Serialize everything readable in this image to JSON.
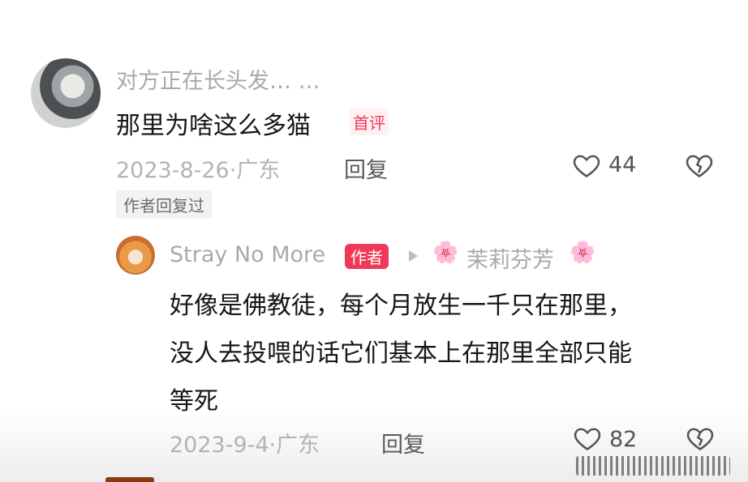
{
  "comment1": {
    "username": "对方正在长头发… …",
    "text": "那里为啥这么多猫",
    "badge": "首评",
    "date_location": "2023-8-26·广东",
    "reply_label": "回复",
    "likes": "44",
    "author_replied": "作者回复过"
  },
  "reply1": {
    "username": "Stray No More",
    "author_badge": "作者",
    "reply_to": "茉莉芬芳",
    "lines": [
      "好像是佛教徒，每个月放生一千只在那里，",
      "没人去投喂的话它们基本上在那里全部只能",
      "等死"
    ],
    "date_location": "2023-9-4·广东",
    "reply_label": "回复",
    "likes": "82"
  },
  "icons": {
    "like": "heart-outline-icon",
    "dislike": "broken-heart-icon",
    "arrow": "triangle-right-icon",
    "flower": "cherry-blossom-icon"
  },
  "colors": {
    "accent": "#f0385a",
    "muted": "#a9a9a9"
  }
}
